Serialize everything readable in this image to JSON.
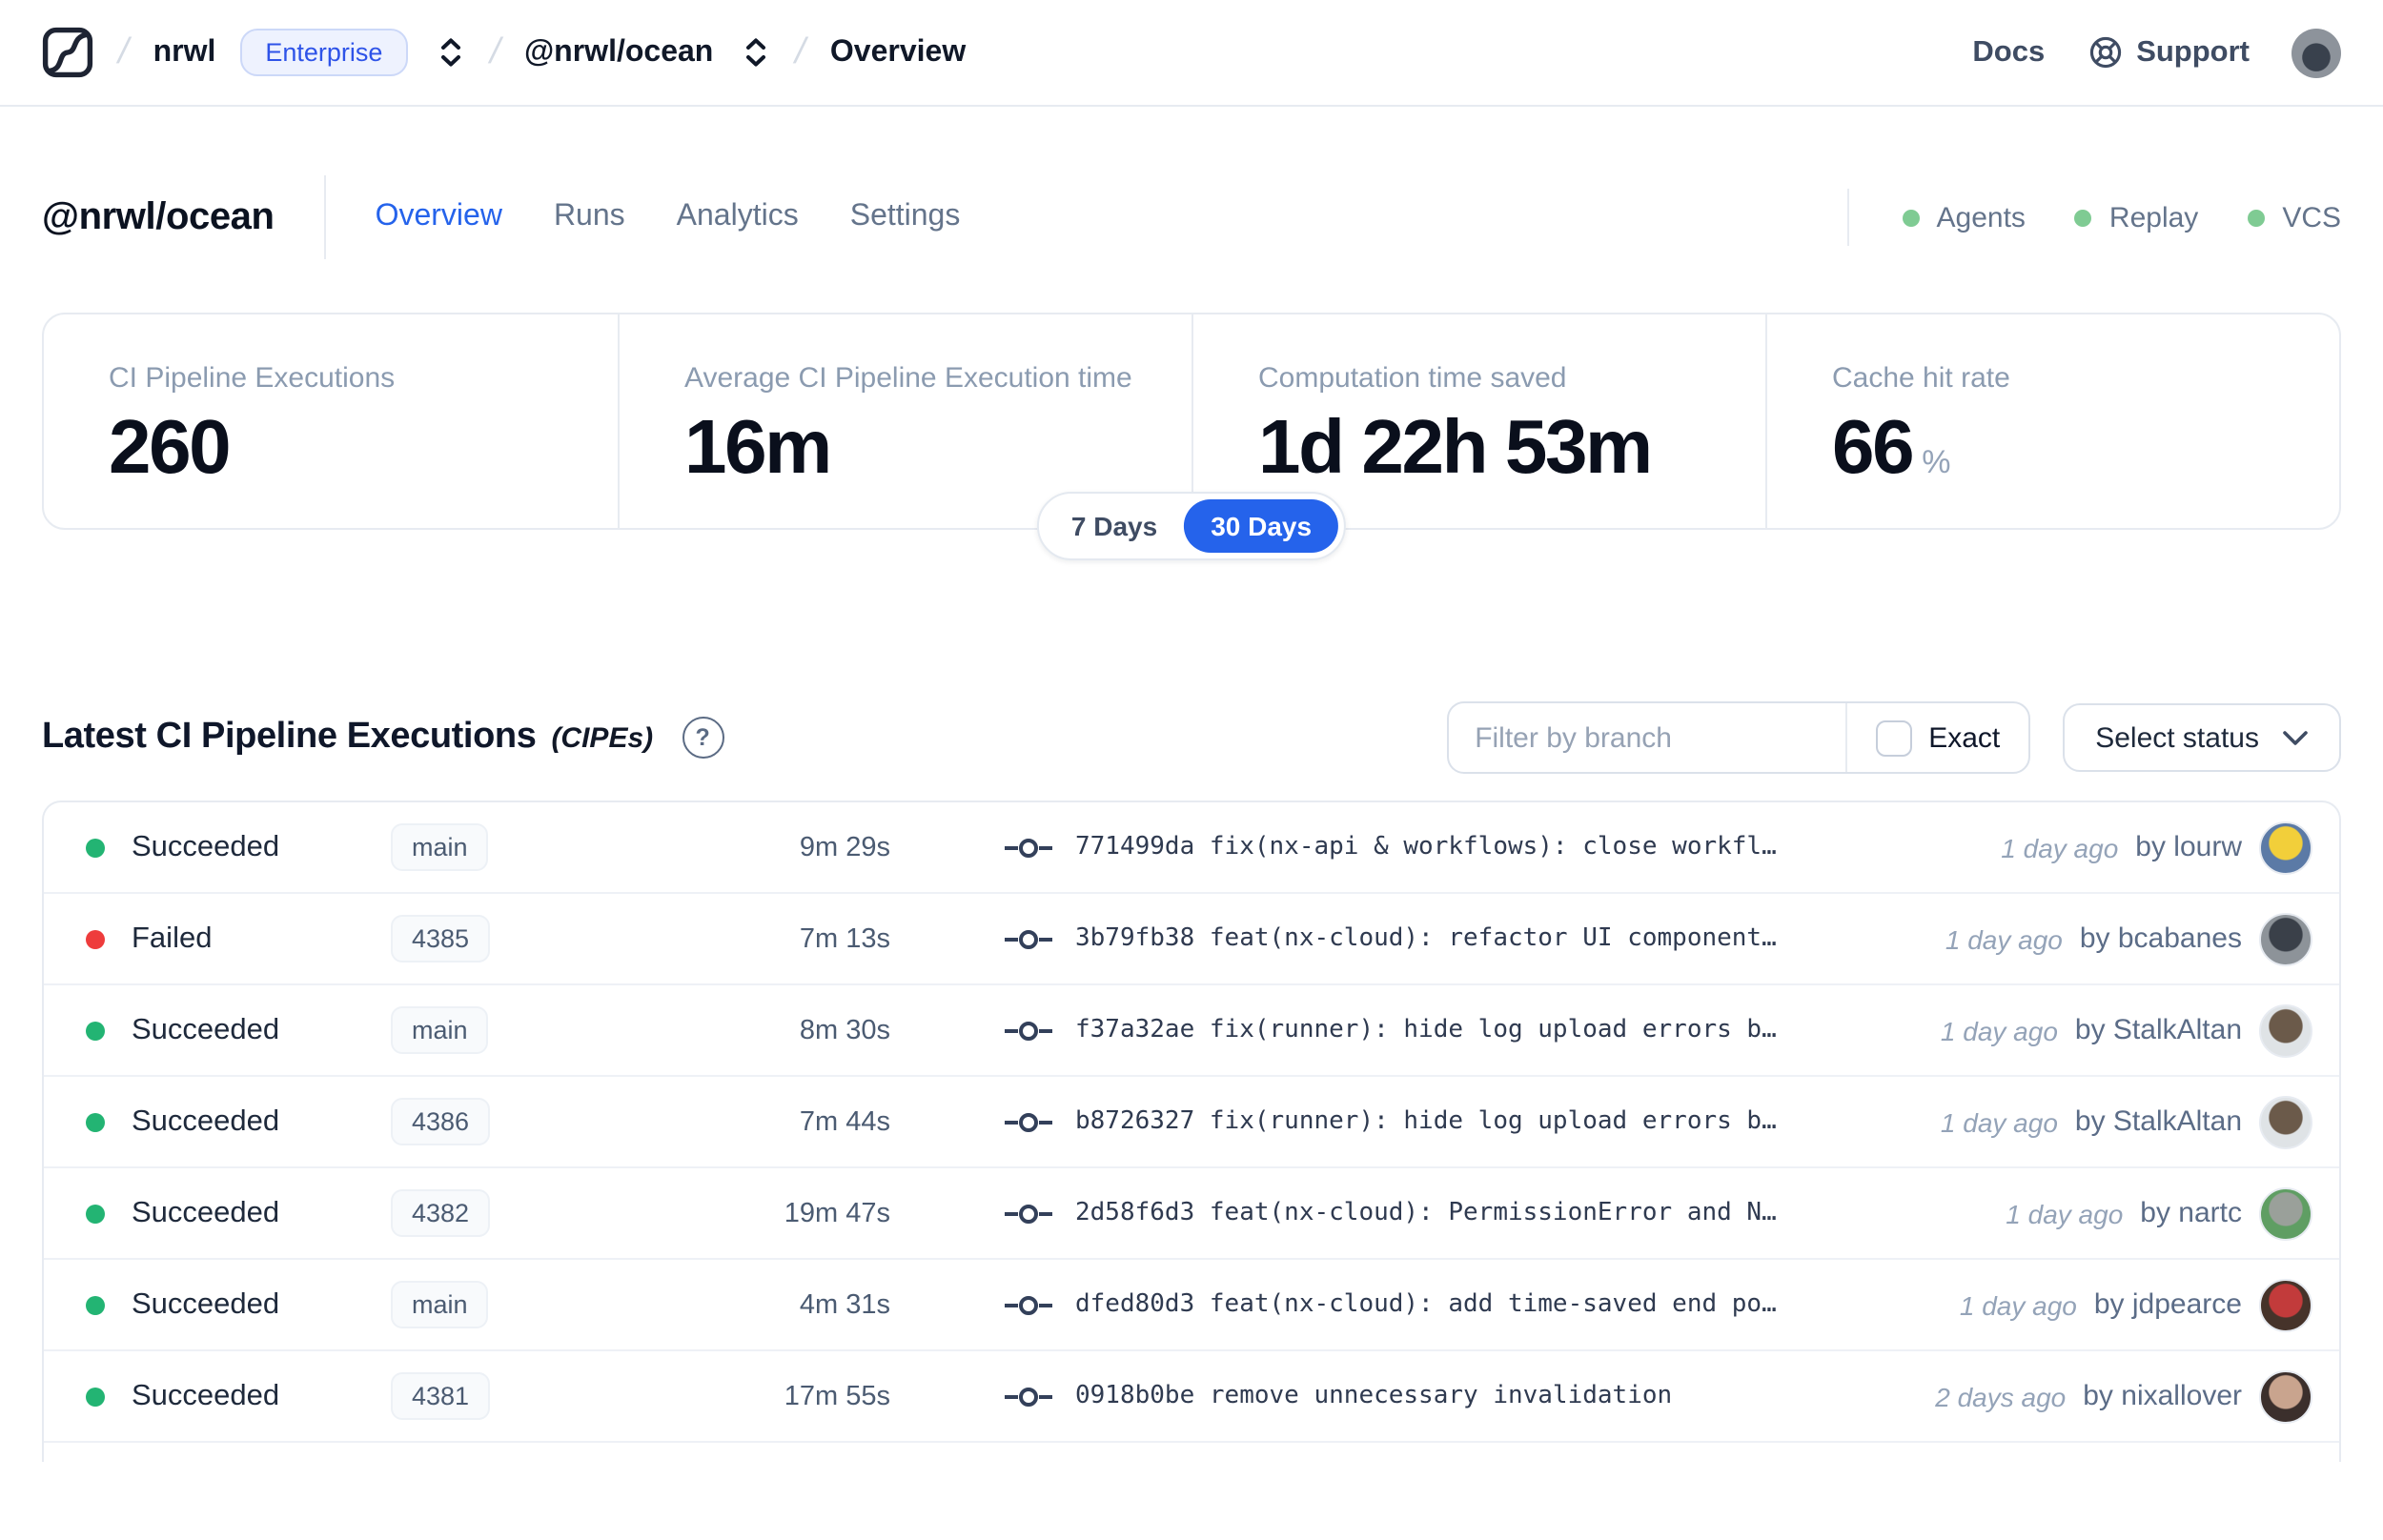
{
  "colors": {
    "accent": "#2563eb",
    "succeeded": "#23b473",
    "failed": "#ee3c3c",
    "legend_dot": "#7fcb93"
  },
  "topbar": {
    "breadcrumb": {
      "org": "nrwl",
      "org_badge": "Enterprise",
      "workspace": "@nrwl/ocean",
      "page": "Overview"
    },
    "docs_label": "Docs",
    "support_label": "Support"
  },
  "header": {
    "workspace": "@nrwl/ocean",
    "tabs": [
      {
        "label": "Overview",
        "active": true
      },
      {
        "label": "Runs",
        "active": false
      },
      {
        "label": "Analytics",
        "active": false
      },
      {
        "label": "Settings",
        "active": false
      }
    ],
    "statuses": [
      {
        "label": "Agents"
      },
      {
        "label": "Replay"
      },
      {
        "label": "VCS"
      }
    ]
  },
  "stats": {
    "cards": [
      {
        "label": "CI Pipeline Executions",
        "value": "260",
        "suffix": ""
      },
      {
        "label": "Average CI Pipeline Execution time",
        "value": "16m",
        "suffix": ""
      },
      {
        "label": "Computation time saved",
        "value": "1d 22h 53m",
        "suffix": ""
      },
      {
        "label": "Cache hit rate",
        "value": "66",
        "suffix": "%"
      }
    ],
    "range_toggle": {
      "options": [
        "7 Days",
        "30 Days"
      ],
      "selected": "30 Days"
    }
  },
  "cipes": {
    "title": "Latest CI Pipeline Executions",
    "title_suffix": "(CIPEs)",
    "filter_placeholder": "Filter by branch",
    "exact_label": "Exact",
    "status_dropdown_label": "Select status",
    "rows": [
      {
        "status": "Succeeded",
        "status_key": "succeeded",
        "branch": "main",
        "duration": "9m 29s",
        "commit_hash": "771499da",
        "commit_message": "fix(nx-api & workflows): close workfl…",
        "time_ago": "1 day ago",
        "author": "by lourw",
        "avatar_colors": [
          "#f2cf3a",
          "#5b7aa6"
        ]
      },
      {
        "status": "Failed",
        "status_key": "failed",
        "branch": "4385",
        "duration": "7m 13s",
        "commit_hash": "3b79fb38",
        "commit_message": "feat(nx-cloud): refactor UI component…",
        "time_ago": "1 day ago",
        "author": "by bcabanes",
        "avatar_colors": [
          "#3a4049",
          "#8d9399"
        ]
      },
      {
        "status": "Succeeded",
        "status_key": "succeeded",
        "branch": "main",
        "duration": "8m 30s",
        "commit_hash": "f37a32ae",
        "commit_message": "fix(runner): hide log upload errors b…",
        "time_ago": "1 day ago",
        "author": "by StalkAltan",
        "avatar_colors": [
          "#6b5a4a",
          "#dfe3e6"
        ]
      },
      {
        "status": "Succeeded",
        "status_key": "succeeded",
        "branch": "4386",
        "duration": "7m 44s",
        "commit_hash": "b8726327",
        "commit_message": "fix(runner): hide log upload errors b…",
        "time_ago": "1 day ago",
        "author": "by StalkAltan",
        "avatar_colors": [
          "#6b5a4a",
          "#dfe3e6"
        ]
      },
      {
        "status": "Succeeded",
        "status_key": "succeeded",
        "branch": "4382",
        "duration": "19m 47s",
        "commit_hash": "2d58f6d3",
        "commit_message": "feat(nx-cloud): PermissionError and N…",
        "time_ago": "1 day ago",
        "author": "by nartc",
        "avatar_colors": [
          "#9aa09a",
          "#5f9e63"
        ]
      },
      {
        "status": "Succeeded",
        "status_key": "succeeded",
        "branch": "main",
        "duration": "4m 31s",
        "commit_hash": "dfed80d3",
        "commit_message": "feat(nx-cloud): add time-saved end po…",
        "time_ago": "1 day ago",
        "author": "by jdpearce",
        "avatar_colors": [
          "#c23b3b",
          "#46332a"
        ]
      },
      {
        "status": "Succeeded",
        "status_key": "succeeded",
        "branch": "4381",
        "duration": "17m 55s",
        "commit_hash": "0918b0be",
        "commit_message": "remove unnecessary invalidation",
        "time_ago": "2 days ago",
        "author": "by nixallover",
        "avatar_colors": [
          "#c9a48e",
          "#3b2f2c"
        ]
      }
    ]
  }
}
